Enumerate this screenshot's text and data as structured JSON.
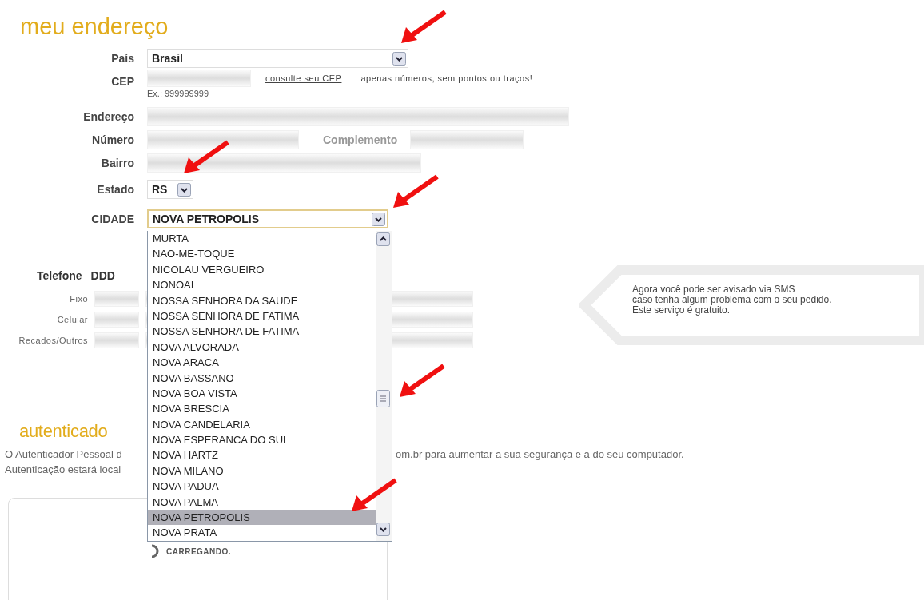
{
  "address": {
    "title": "meu endereço",
    "fields": [
      {
        "kind": "select",
        "label": "País",
        "value": "Brasil"
      },
      {
        "kind": "cep",
        "label": "CEP",
        "link": "consulte seu CEP",
        "hint": "apenas números, sem pontos ou traços!",
        "example": "Ex.: 999999999"
      },
      {
        "kind": "text",
        "label": "Endereço"
      },
      {
        "kind": "pair",
        "label": "Número",
        "second_label": "Complemento"
      },
      {
        "kind": "text",
        "label": "Bairro"
      },
      {
        "kind": "select",
        "label": "Estado",
        "value": "RS"
      },
      {
        "kind": "select",
        "label": "CIDADE",
        "value": "NOVA PETROPOLIS",
        "expanded": true
      }
    ],
    "city_list": [
      {
        "label": "MURTA",
        "selected": false
      },
      {
        "label": "NAO-ME-TOQUE",
        "selected": false
      },
      {
        "label": "NICOLAU VERGUEIRO",
        "selected": false
      },
      {
        "label": "NONOAI",
        "selected": false
      },
      {
        "label": "NOSSA SENHORA DA SAUDE",
        "selected": false
      },
      {
        "label": "NOSSA SENHORA DE FATIMA",
        "selected": false
      },
      {
        "label": "NOSSA SENHORA DE FATIMA",
        "selected": false
      },
      {
        "label": "NOVA ALVORADA",
        "selected": false
      },
      {
        "label": "NOVA ARACA",
        "selected": false
      },
      {
        "label": "NOVA BASSANO",
        "selected": false
      },
      {
        "label": "NOVA BOA VISTA",
        "selected": false
      },
      {
        "label": "NOVA BRESCIA",
        "selected": false
      },
      {
        "label": "NOVA CANDELARIA",
        "selected": false
      },
      {
        "label": "NOVA ESPERANCA DO SUL",
        "selected": false
      },
      {
        "label": "NOVA HARTZ",
        "selected": false
      },
      {
        "label": "NOVA MILANO",
        "selected": false
      },
      {
        "label": "NOVA PADUA",
        "selected": false
      },
      {
        "label": "NOVA PALMA",
        "selected": false
      },
      {
        "label": "NOVA PETROPOLIS",
        "selected": true
      },
      {
        "label": "NOVA PRATA",
        "selected": false
      }
    ]
  },
  "phone": {
    "label": "Telefone",
    "ddd_label": "DDD",
    "rows": [
      "Fixo",
      "Celular",
      "Recados/Outros"
    ]
  },
  "sms_tip": [
    "Agora você pode ser avisado via SMS",
    "caso tenha algum problema com o seu pedido.",
    "Este serviço é gratuito."
  ],
  "authenticator": {
    "title": "autenticado",
    "lines": [
      {
        "left": "O Autenticador Pessoal d",
        "right": "om.br para aumentar a sua segurança e a do seu computador."
      },
      {
        "left": "Autenticação estará local"
      }
    ],
    "loading": "CARREGANDO."
  }
}
